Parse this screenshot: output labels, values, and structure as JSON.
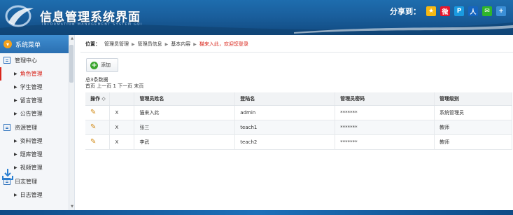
{
  "header": {
    "title": "信息管理系统界面",
    "subtitle": "INFORMATION MANAGEMENT SYSTEM GUI",
    "share_label": "分享到：",
    "share_icons": [
      {
        "name": "qzone-icon",
        "glyph": "★",
        "color": "#f6b812"
      },
      {
        "name": "weibo-icon",
        "glyph": "微",
        "color": "#e6162d"
      },
      {
        "name": "tencent-weibo-icon",
        "glyph": "P",
        "color": "#1a9ae0"
      },
      {
        "name": "renren-icon",
        "glyph": "人",
        "color": "#1565c0"
      },
      {
        "name": "wechat-icon",
        "glyph": "✉",
        "color": "#2fb52b"
      },
      {
        "name": "more-share-icon",
        "glyph": "+",
        "color": "#3b8fd6"
      }
    ]
  },
  "sidebar": {
    "title": "系统菜单",
    "groups": [
      {
        "label": "管理中心",
        "items": [
          "角色管理",
          "学生管理",
          "留言管理",
          "公告管理"
        ]
      },
      {
        "label": "资源管理",
        "items": [
          "资料管理",
          "题库管理",
          "视频管理"
        ]
      },
      {
        "label": "日志管理",
        "items": [
          "日志管理"
        ]
      }
    ],
    "active_item": "角色管理"
  },
  "breadcrumb": {
    "label": "位置：",
    "parts": [
      "管理员管理",
      "管理员信息",
      "基本内容"
    ],
    "current": "猫来入此，欢迎您登录"
  },
  "toolbar": {
    "add_label": "添加"
  },
  "pager": {
    "summary": "总3条数据",
    "nav": "首页 上一页 1 下一页 末页"
  },
  "table": {
    "columns": [
      "操作 ◇",
      "",
      "管理员姓名",
      "登陆名",
      "管理员密码",
      "管理级别"
    ],
    "rows": [
      {
        "delete": "X",
        "name": "猫来入此",
        "login": "admin",
        "password": "*******",
        "level": "系统管理员"
      },
      {
        "delete": "X",
        "name": "张三",
        "login": "teach1",
        "password": "*******",
        "level": "教师"
      },
      {
        "delete": "X",
        "name": "李武",
        "login": "teach2",
        "password": "*******",
        "level": "教师"
      }
    ]
  }
}
